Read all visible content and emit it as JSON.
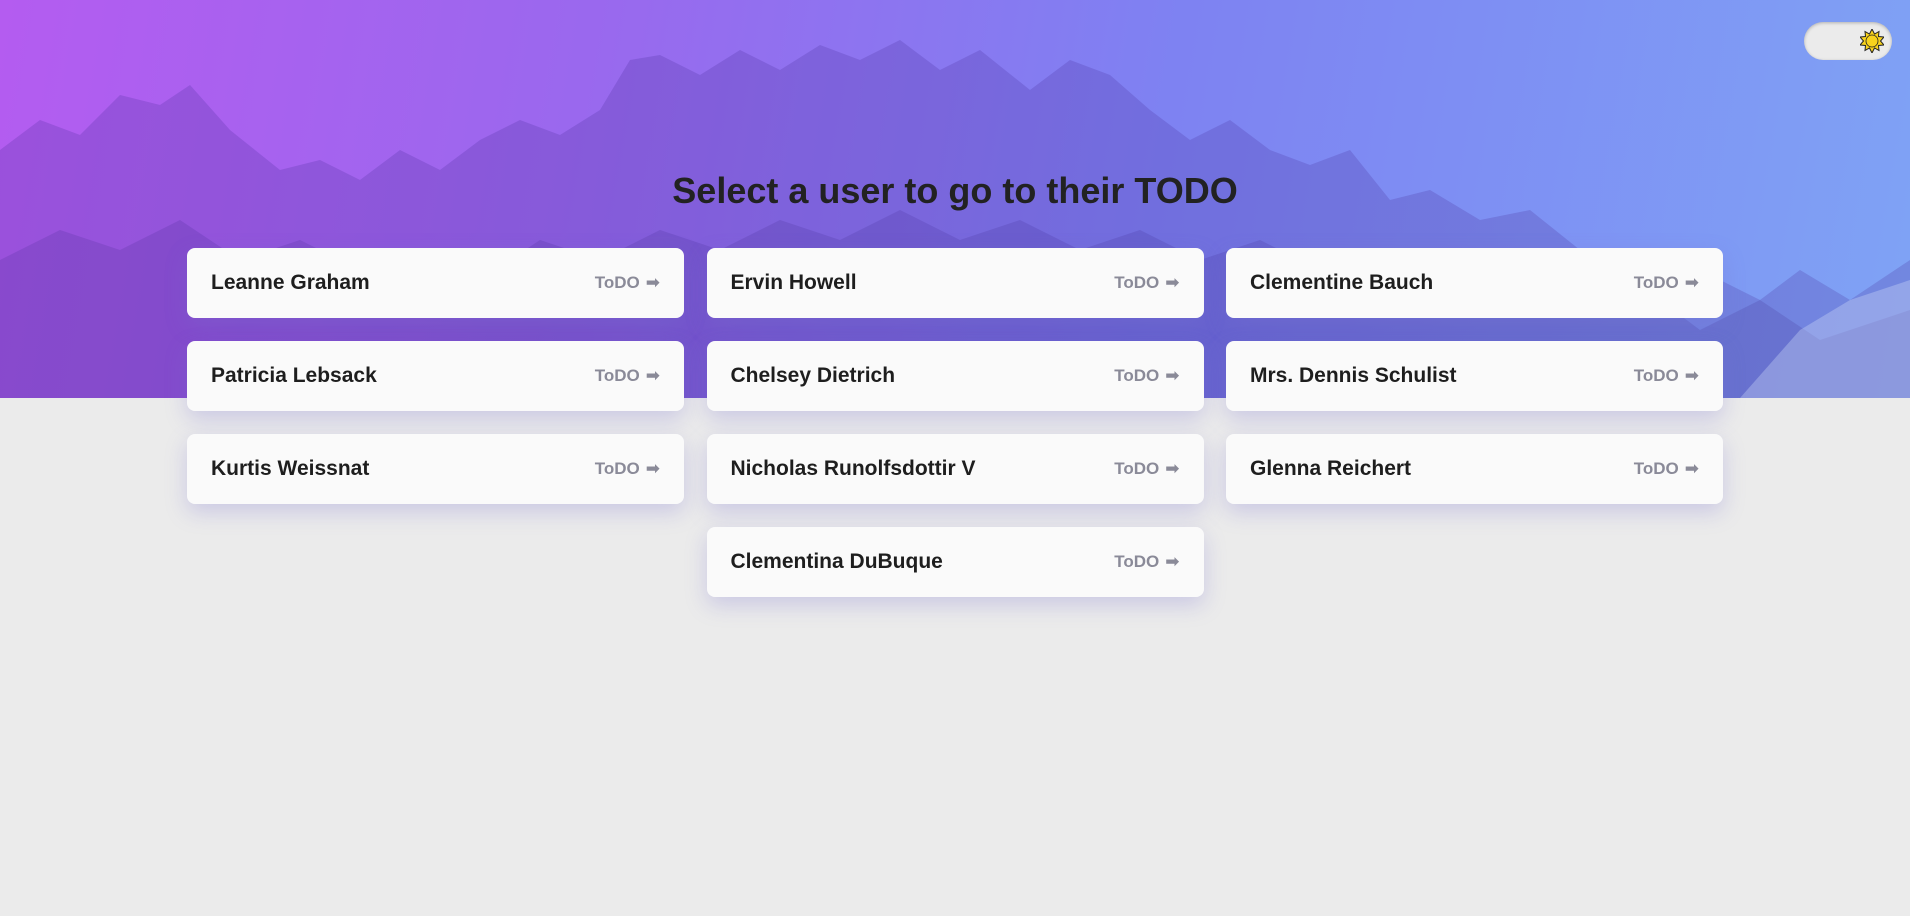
{
  "page": {
    "title": "Select a user to go to their TODO"
  },
  "theme_toggle": {
    "icon": "sun-icon",
    "state": "light"
  },
  "users": [
    {
      "name": "Leanne Graham",
      "link": "ToDO"
    },
    {
      "name": "Ervin Howell",
      "link": "ToDO"
    },
    {
      "name": "Clementine Bauch",
      "link": "ToDO"
    },
    {
      "name": "Patricia Lebsack",
      "link": "ToDO"
    },
    {
      "name": "Chelsey Dietrich",
      "link": "ToDO"
    },
    {
      "name": "Mrs. Dennis Schulist",
      "link": "ToDO"
    },
    {
      "name": "Kurtis Weissnat",
      "link": "ToDO"
    },
    {
      "name": "Nicholas Runolfsdottir V",
      "link": "ToDO"
    },
    {
      "name": "Glenna Reichert",
      "link": "ToDO"
    },
    {
      "name": "Clementina DuBuque",
      "link": "ToDO"
    }
  ],
  "icons": {
    "card_arrow": "arrow-right-icon",
    "arrow_glyph": "➡"
  },
  "colors": {
    "hero_gradient_start": "#b45cf0",
    "hero_gradient_end": "#7fa3f5",
    "background": "#ebebeb",
    "card": "#fafafa",
    "link_text": "#8a8a98",
    "sun": "#f7d21c"
  }
}
